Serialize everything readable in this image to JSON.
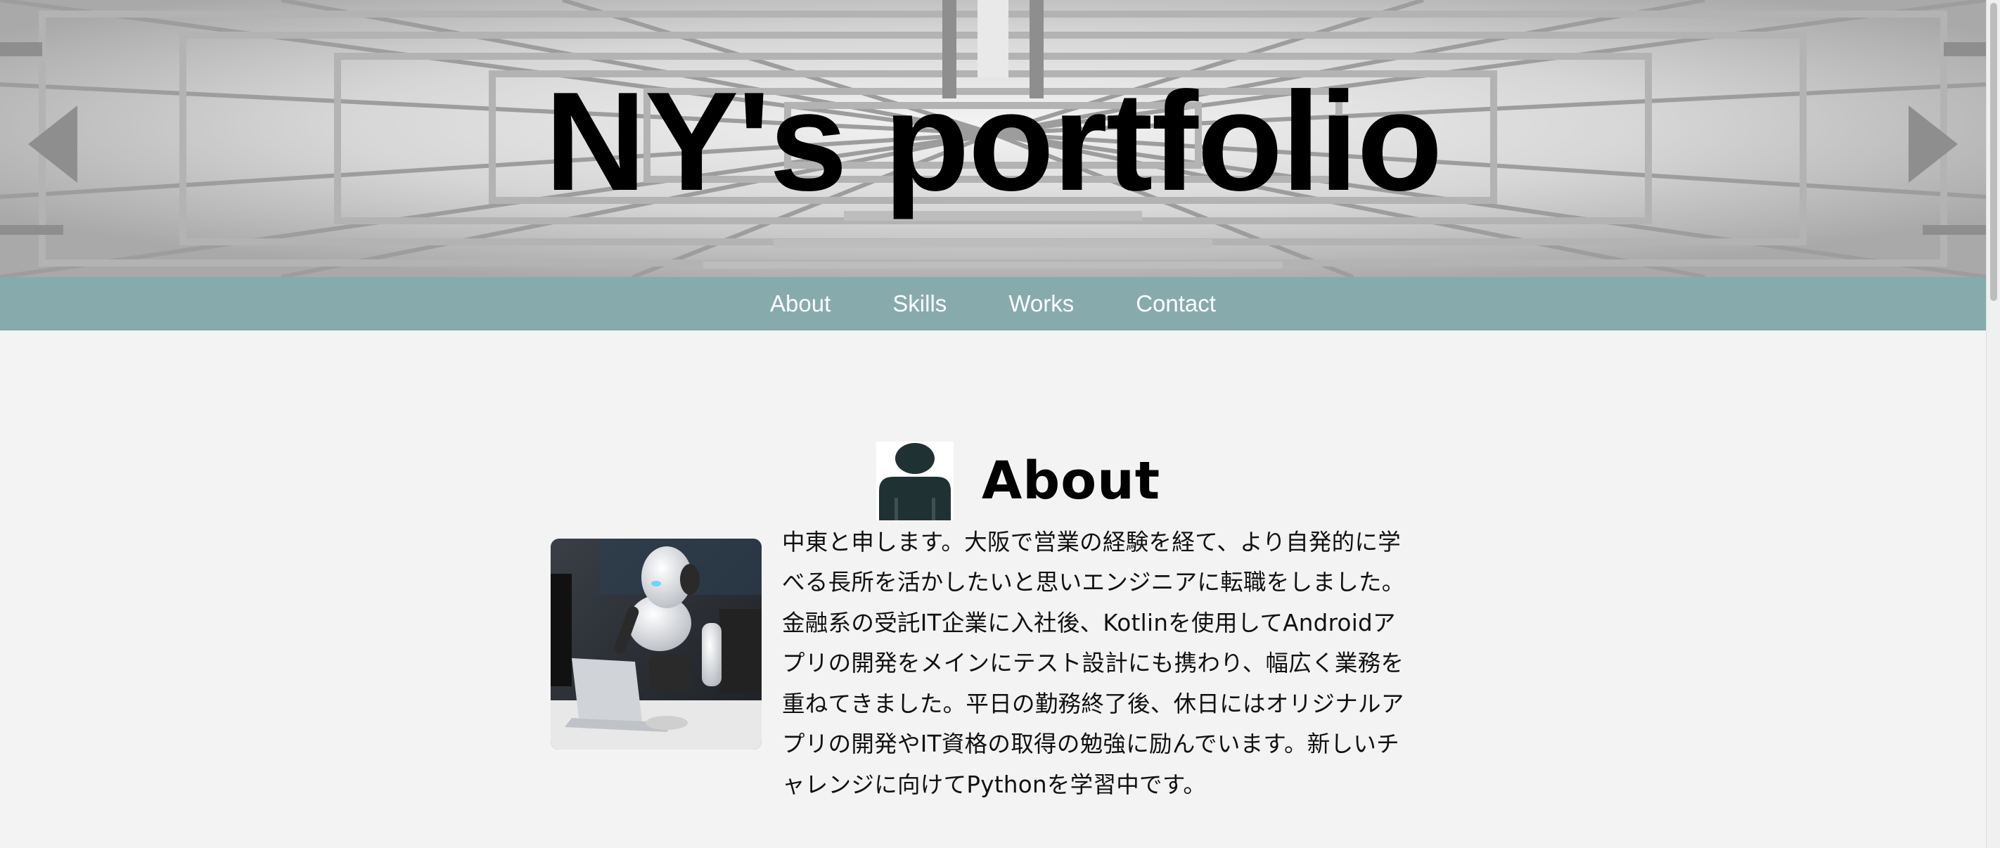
{
  "hero": {
    "title": "NY's portfolio"
  },
  "nav": {
    "items": [
      "About",
      "Skills",
      "Works",
      "Contact"
    ]
  },
  "about": {
    "heading_icon": "person-icon",
    "heading": "About",
    "photo": "robot-with-laptop-photo",
    "text": "中東と申します。大阪で営業の経験を経て、より自発的に学べる長所を活かしたいと思いエンジニアに転職をしました。金融系の受託IT企業に入社後、Kotlinを使用してAndroidアプリの開発をメインにテスト設計にも携わり、幅広く業務を重ねてきました。平日の勤務終了後、休日にはオリジナルアプリの開発やIT資格の取得の勉強に励んでいます。新しいチャレンジに向けてPythonを学習中です。"
  },
  "colors": {
    "nav_bg": "#87abad",
    "page_bg": "#f3f3f3",
    "icon": "#1f3133"
  }
}
